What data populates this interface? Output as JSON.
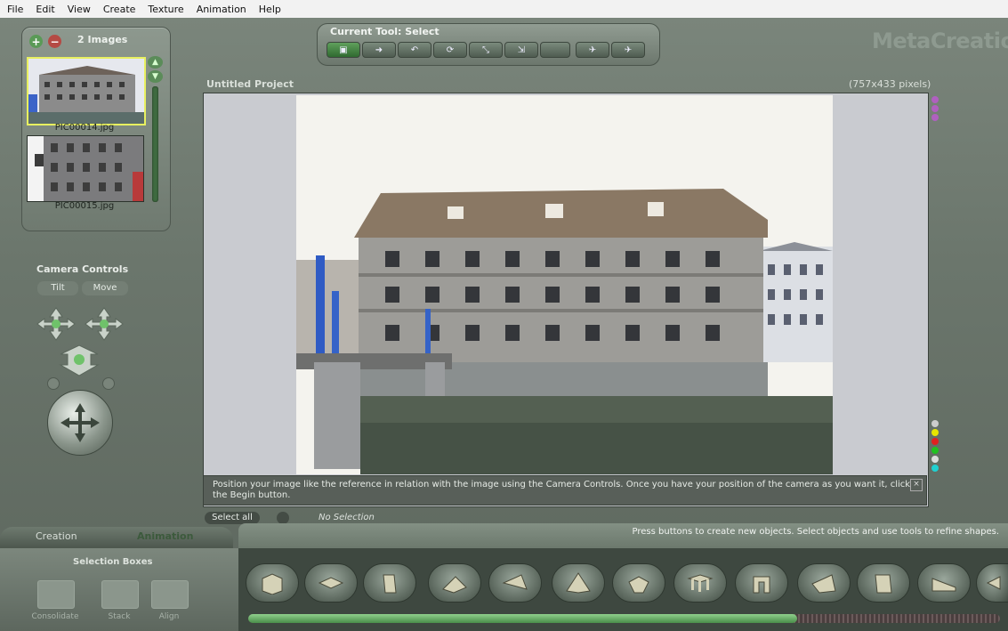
{
  "menu": [
    "File",
    "Edit",
    "View",
    "Create",
    "Texture",
    "Animation",
    "Help"
  ],
  "images_panel": {
    "count_label": "2 Images",
    "thumbnails": [
      {
        "caption": "PIC00014.jpg"
      },
      {
        "caption": "PIC00015.jpg"
      }
    ]
  },
  "toolbar": {
    "title": "Current Tool: Select",
    "buttons": [
      "select",
      "move",
      "lasso",
      "rotate",
      "scale",
      "resize",
      "extrude",
      "fly"
    ]
  },
  "logo": "MetaCreations.",
  "project": {
    "title": "Untitled Project",
    "size": "(757x433 pixels)",
    "info_text": "Position your image like the reference in relation with the image using the Camera Controls. Once you have your position of the camera as you want it, click the Begin button.",
    "close": "×",
    "indicator_colors": [
      "#ccc",
      "#e6e600",
      "#e02020",
      "#20c020",
      "#cccccc",
      "#20d0d0"
    ],
    "top_dots_color": "#b060c0"
  },
  "selection": {
    "select_all": "Select all",
    "no_selection": "No Selection"
  },
  "camera": {
    "title": "Camera Controls",
    "tabs": [
      "Tilt",
      "Move"
    ]
  },
  "bottom": {
    "tabs": [
      "Creation",
      "Animation"
    ],
    "status": "Press buttons to create new objects. Select objects and use tools to refine shapes.",
    "selection_boxes_title": "Selection Boxes",
    "selection_boxes": [
      "Consolidate",
      "Stack",
      "Align"
    ],
    "shapes": [
      "cube",
      "flat-disc",
      "slab",
      "pyramid-wedge",
      "cone-flat",
      "pyramid",
      "half-prism",
      "table",
      "arch",
      "wedge",
      "box",
      "ramp",
      "partial"
    ],
    "progress": 0.73
  }
}
